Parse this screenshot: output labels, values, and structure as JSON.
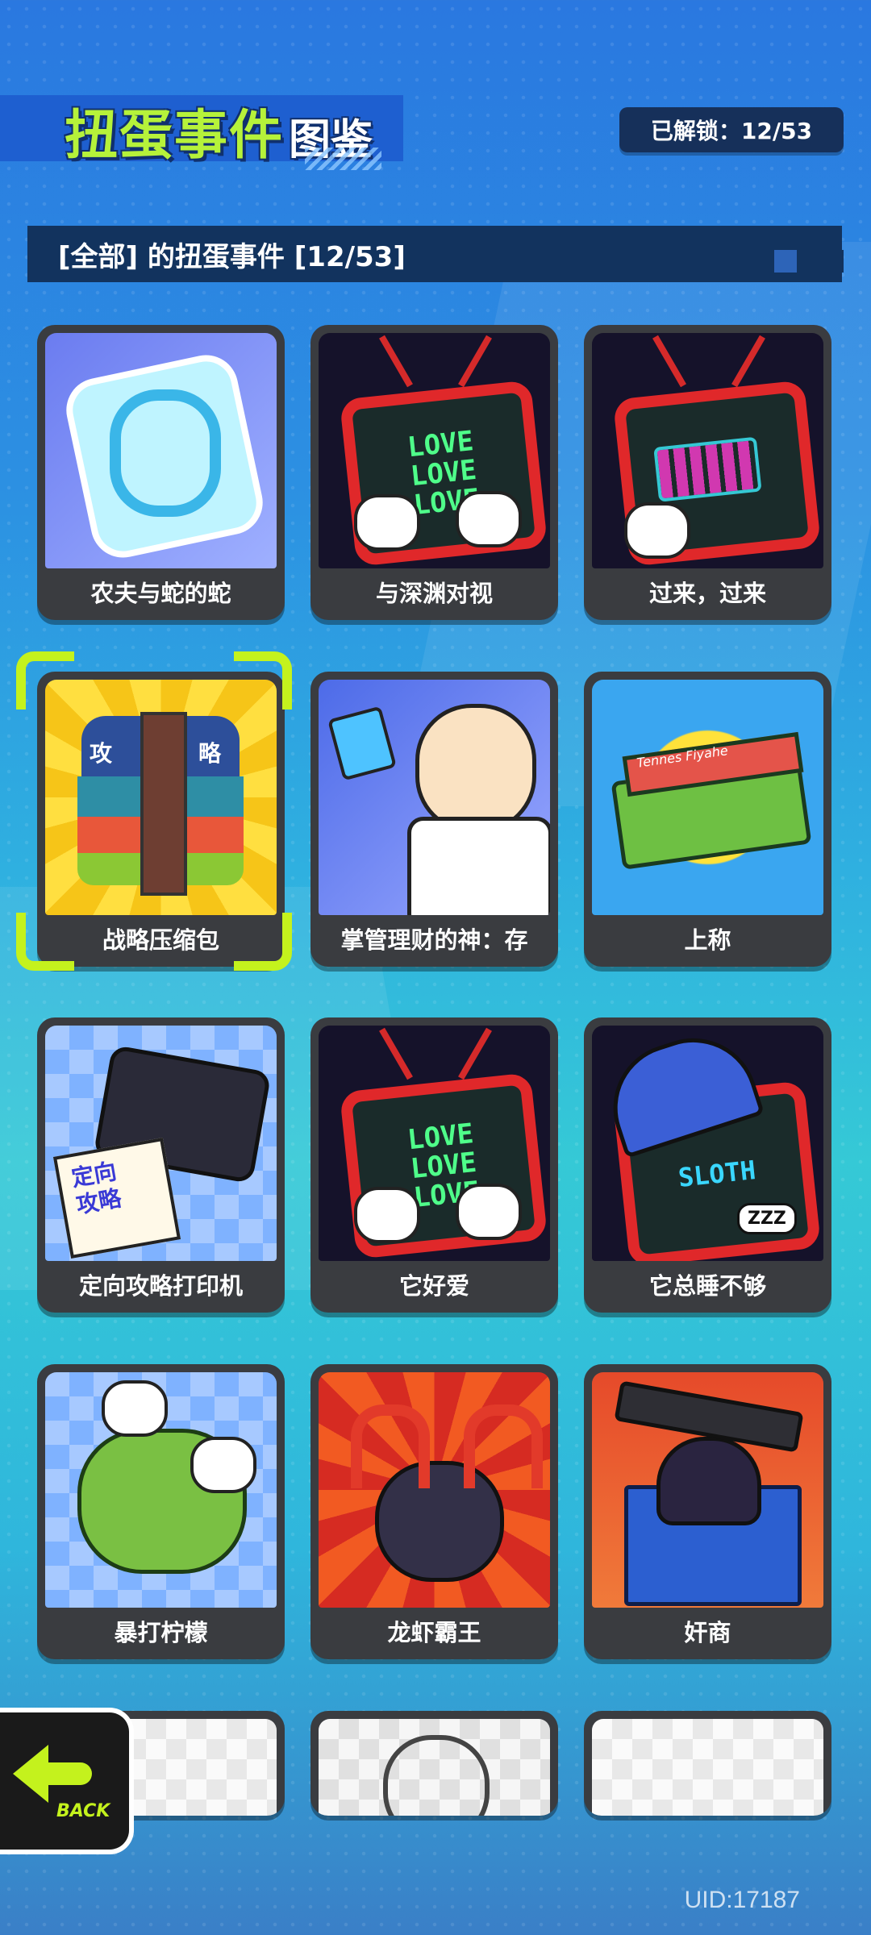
{
  "header": {
    "title_main": "扭蛋事件",
    "title_sub": "图鉴",
    "unlock_label": "已解锁：12/53"
  },
  "section": {
    "title": "[全部] 的扭蛋事件 [12/53]"
  },
  "cards": [
    {
      "label": "农夫与蛇的蛇",
      "colors": [
        "#5a73e6",
        "#7fd8ff"
      ]
    },
    {
      "label": "与深渊对视",
      "tv_text": [
        "LOVE",
        "LOVE",
        "LOVE"
      ]
    },
    {
      "label": "过来，过来"
    },
    {
      "label": "战略压缩包",
      "art_text": [
        "攻",
        "略"
      ]
    },
    {
      "label": "掌管理财的神：存"
    },
    {
      "label": "上称",
      "art_text": [
        "Tennes Fiyahe"
      ]
    },
    {
      "label": "定向攻略打印机",
      "art_text": [
        "定向",
        "攻略"
      ]
    },
    {
      "label": "它好爱",
      "tv_text": [
        "LOVE",
        "LOVE",
        "LOVE"
      ]
    },
    {
      "label": "它总睡不够",
      "tv_text": [
        "SLOTH"
      ],
      "art_text": [
        "ZZZ"
      ]
    },
    {
      "label": "暴打柠檬"
    },
    {
      "label": "龙虾霸王"
    },
    {
      "label": "奸商"
    }
  ],
  "back": {
    "label": "BACK"
  },
  "footer": {
    "uid": "UID:17187"
  }
}
